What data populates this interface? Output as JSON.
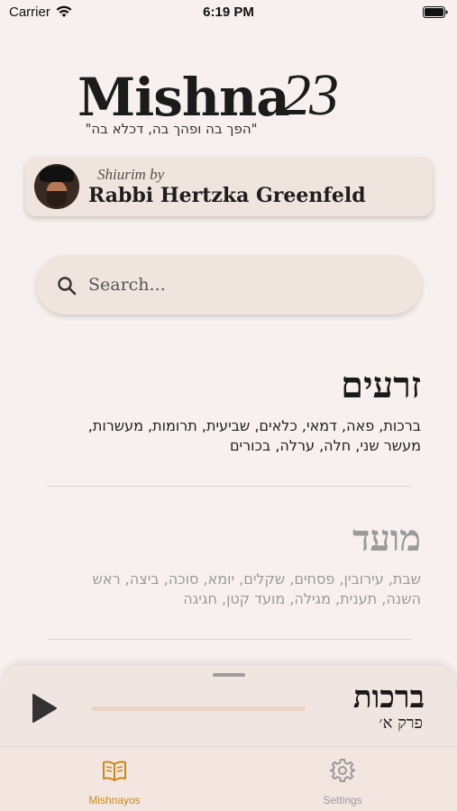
{
  "status_bar": {
    "carrier": "Carrier",
    "time": "6:19 PM"
  },
  "logo": {
    "name": "Mishna",
    "number": "23",
    "tagline": "\"הפך בה ופהך בה, דכלא בה\""
  },
  "rabbi_card": {
    "label": "Shiurim by",
    "name": "Rabbi Hertzka Greenfeld"
  },
  "search": {
    "placeholder": "Search..."
  },
  "sedarim": [
    {
      "title": "זרעים",
      "tractates": "ברכות, פאה, דמאי, כלאים, שביעית, תרומות, מעשרות, מעשר שני, חלה, ערלה, בכורים"
    },
    {
      "title": "מועד",
      "tractates": "שבת, עירובין, פסחים, שקלים, יומא, סוכה, ביצה, ראש השנה, תענית, מגילה, מועד קטן, חגיגה"
    }
  ],
  "player": {
    "title": "ברכות",
    "subtitle": "פרק א׳",
    "progress": 0
  },
  "tab_bar": {
    "tabs": [
      {
        "label": "Mishnayos",
        "icon": "book-icon",
        "selected": true
      },
      {
        "label": "Settings",
        "icon": "gear-icon",
        "selected": false
      }
    ]
  },
  "colors": {
    "background": "#f7f0ee",
    "card": "#efe4de",
    "accent": "#c8891a",
    "inactive": "#9a9a9a",
    "progress_track": "#ecd3c3"
  }
}
